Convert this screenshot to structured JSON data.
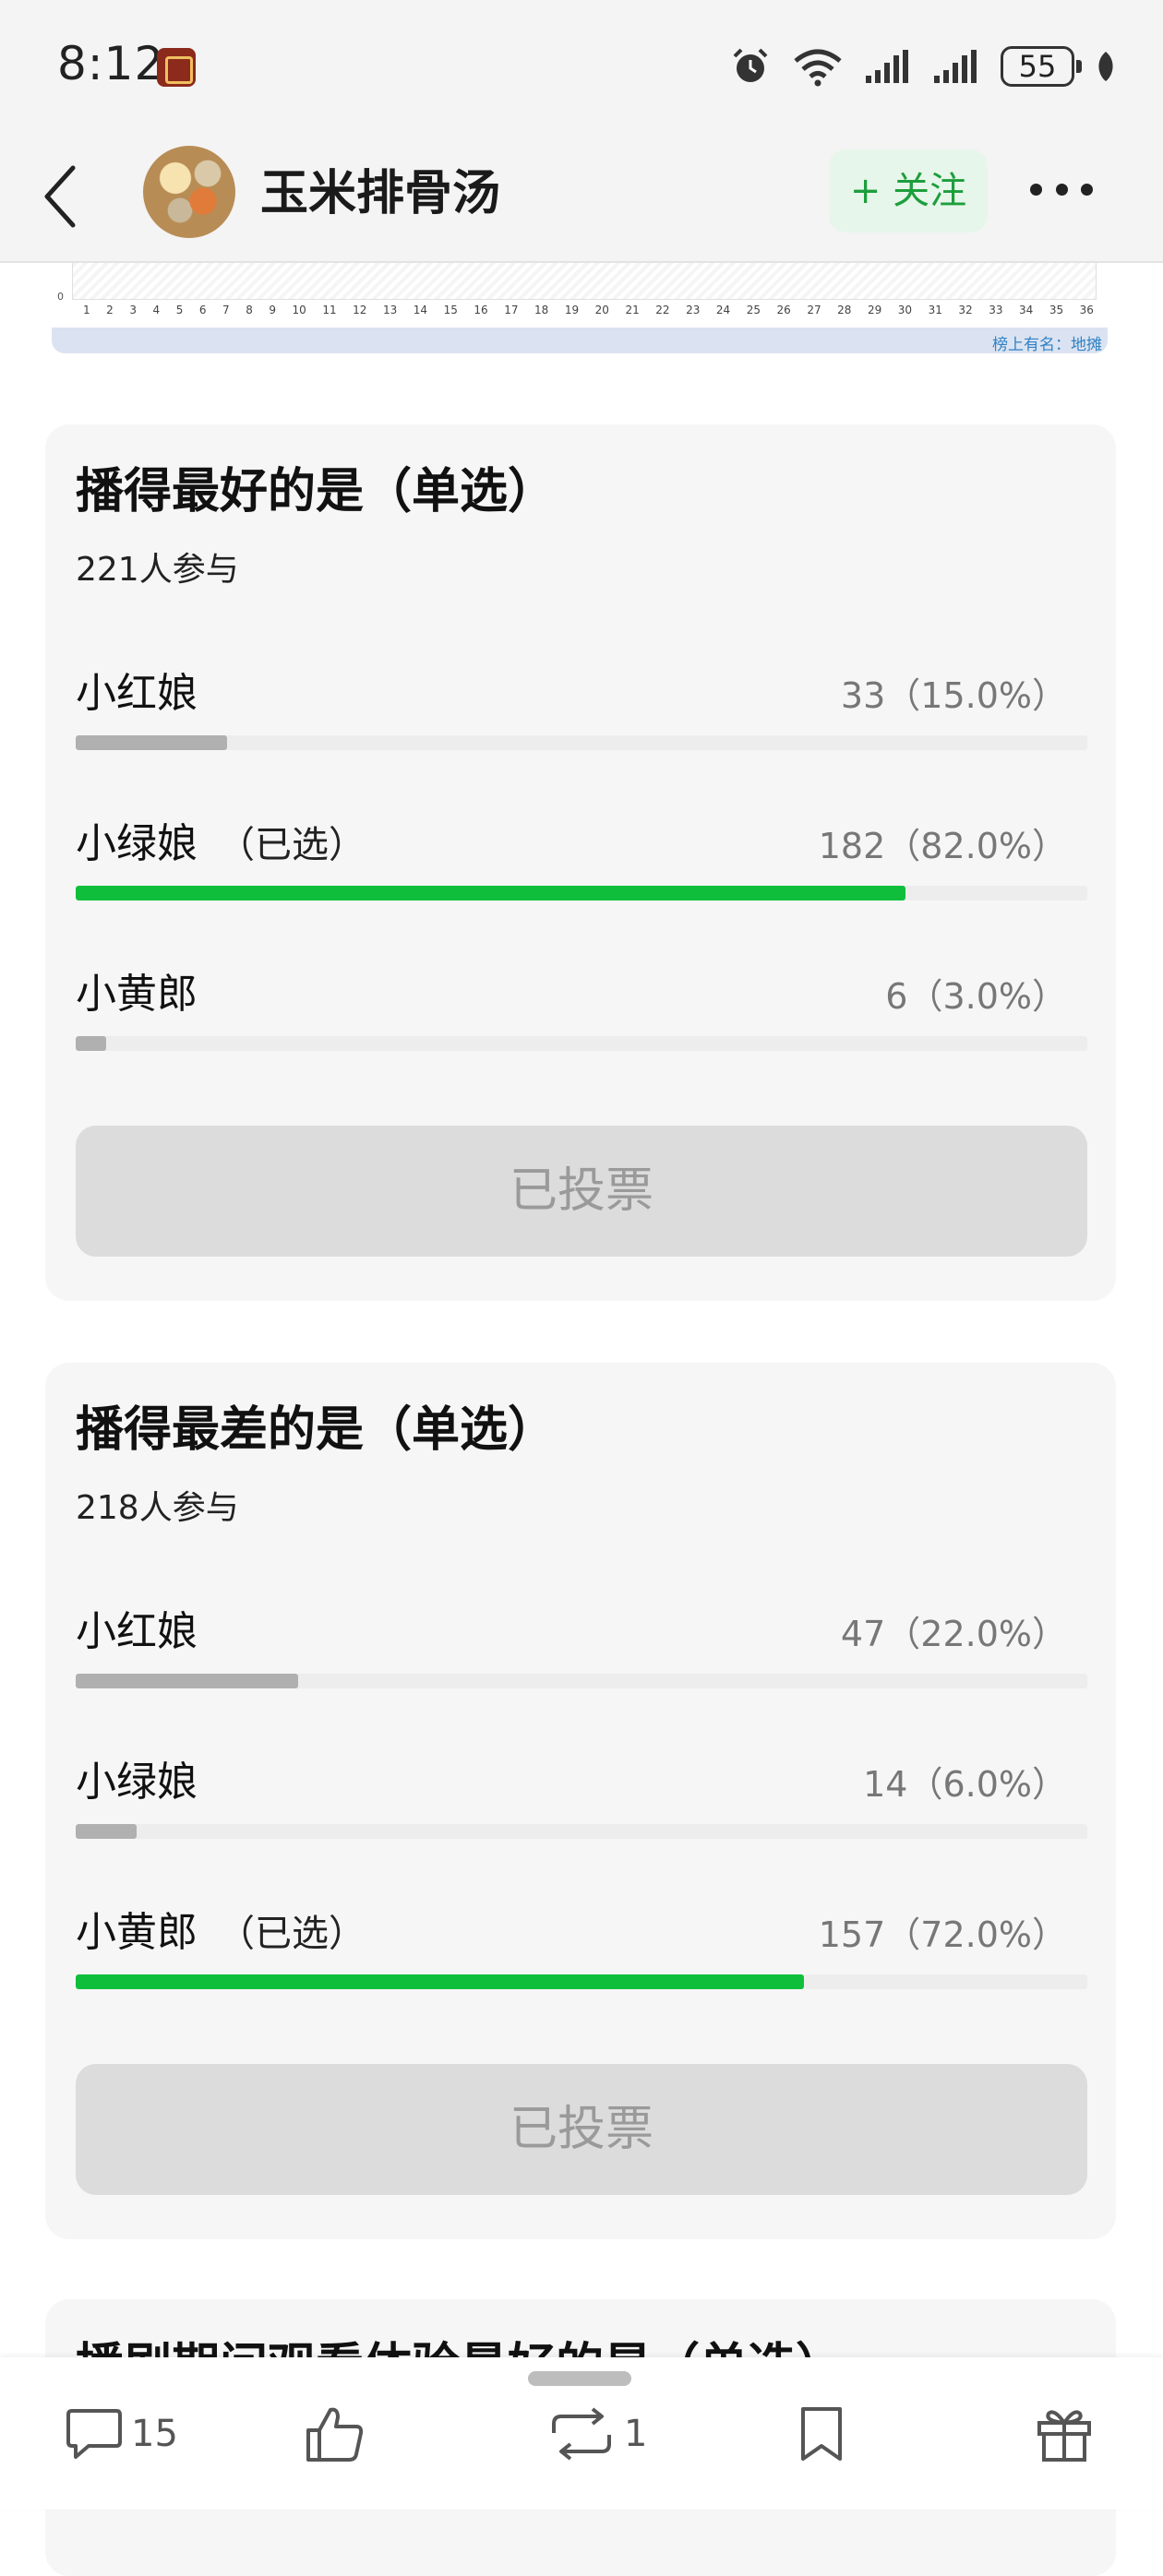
{
  "status_bar": {
    "time": "8:12",
    "battery": "55"
  },
  "header": {
    "title": "玉米排骨汤",
    "follow_label": "+ 关注"
  },
  "chart_fragment": {
    "y_zero": "0",
    "x_ticks": [
      "1",
      "2",
      "3",
      "4",
      "5",
      "6",
      "7",
      "8",
      "9",
      "10",
      "11",
      "12",
      "13",
      "14",
      "15",
      "16",
      "17",
      "18",
      "19",
      "20",
      "21",
      "22",
      "23",
      "24",
      "25",
      "26",
      "27",
      "28",
      "29",
      "30",
      "31",
      "32",
      "33",
      "34",
      "35",
      "36"
    ],
    "footnote": "榜上有名：地摊"
  },
  "polls": [
    {
      "title": "播得最好的是（单选）",
      "participants": "221人参与",
      "options": [
        {
          "label": "小红娘",
          "selected_tag": "",
          "count": "33（15.0%）",
          "percent": 15.0,
          "selected": false
        },
        {
          "label": "小绿娘",
          "selected_tag": "（已选）",
          "count": "182（82.0%）",
          "percent": 82.0,
          "selected": true
        },
        {
          "label": "小黄郎",
          "selected_tag": "",
          "count": "6（3.0%）",
          "percent": 3.0,
          "selected": false
        }
      ],
      "button_label": "已投票"
    },
    {
      "title": "播得最差的是（单选）",
      "participants": "218人参与",
      "options": [
        {
          "label": "小红娘",
          "selected_tag": "",
          "count": "47（22.0%）",
          "percent": 22.0,
          "selected": false
        },
        {
          "label": "小绿娘",
          "selected_tag": "",
          "count": "14（6.0%）",
          "percent": 6.0,
          "selected": false
        },
        {
          "label": "小黄郎",
          "selected_tag": "（已选）",
          "count": "157（72.0%）",
          "percent": 72.0,
          "selected": true
        }
      ],
      "button_label": "已投票"
    },
    {
      "title": "播剧期间观看体验最好的是（单选）"
    }
  ],
  "toolbar": {
    "comments_count": "15",
    "reposts_count": "1"
  },
  "colors": {
    "selected_bar": "#0fbf3b",
    "unselected_bar": "#b0b0b0",
    "follow_text": "#1d9e3c",
    "follow_bg": "#e7f6ea"
  },
  "icons": [
    "back-icon",
    "more-icon",
    "alarm-icon",
    "wifi-icon",
    "signal-icon",
    "battery-icon",
    "leaf-icon",
    "comment-icon",
    "like-icon",
    "repost-icon",
    "bookmark-icon",
    "gift-icon"
  ]
}
